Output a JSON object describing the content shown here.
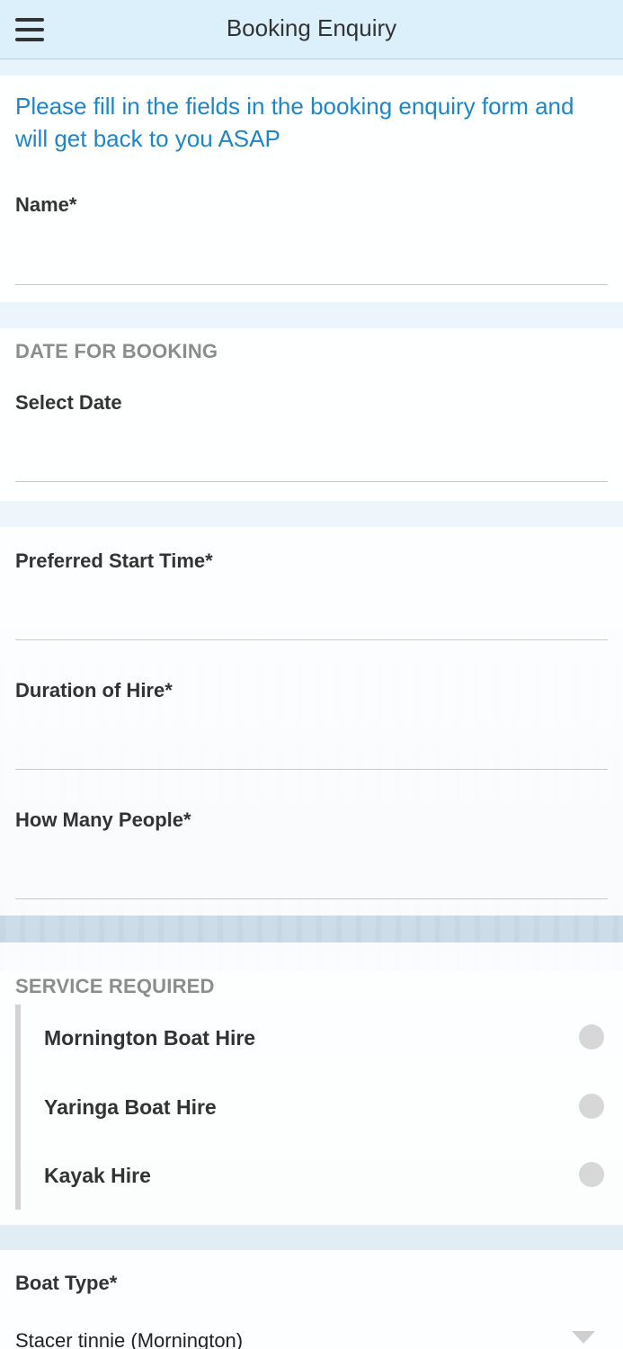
{
  "header": {
    "title": "Booking Enquiry",
    "menu_icon": "hamburger-menu-icon"
  },
  "intro": "Please fill in the fields in the booking enquiry form and will get back to you ASAP",
  "fields": {
    "name": {
      "label": "Name*",
      "value": ""
    },
    "date_section": "DATE FOR BOOKING",
    "select_date": {
      "label": "Select Date",
      "value": ""
    },
    "start_time": {
      "label": "Preferred Start Time*",
      "value": ""
    },
    "duration": {
      "label": "Duration of Hire*",
      "value": ""
    },
    "people": {
      "label": "How Many People*",
      "value": ""
    }
  },
  "service": {
    "heading": "SERVICE REQUIRED",
    "options": [
      {
        "label": "Mornington Boat Hire",
        "selected": false
      },
      {
        "label": "Yaringa Boat Hire",
        "selected": false
      },
      {
        "label": "Kayak Hire",
        "selected": false
      }
    ]
  },
  "boat_type": {
    "label": "Boat Type*",
    "selected": "Stacer tinnie (Mornington)",
    "icon": "chevron-down-icon"
  },
  "colors": {
    "accent": "#2185c5",
    "header_bg": "#dcf0fc"
  }
}
